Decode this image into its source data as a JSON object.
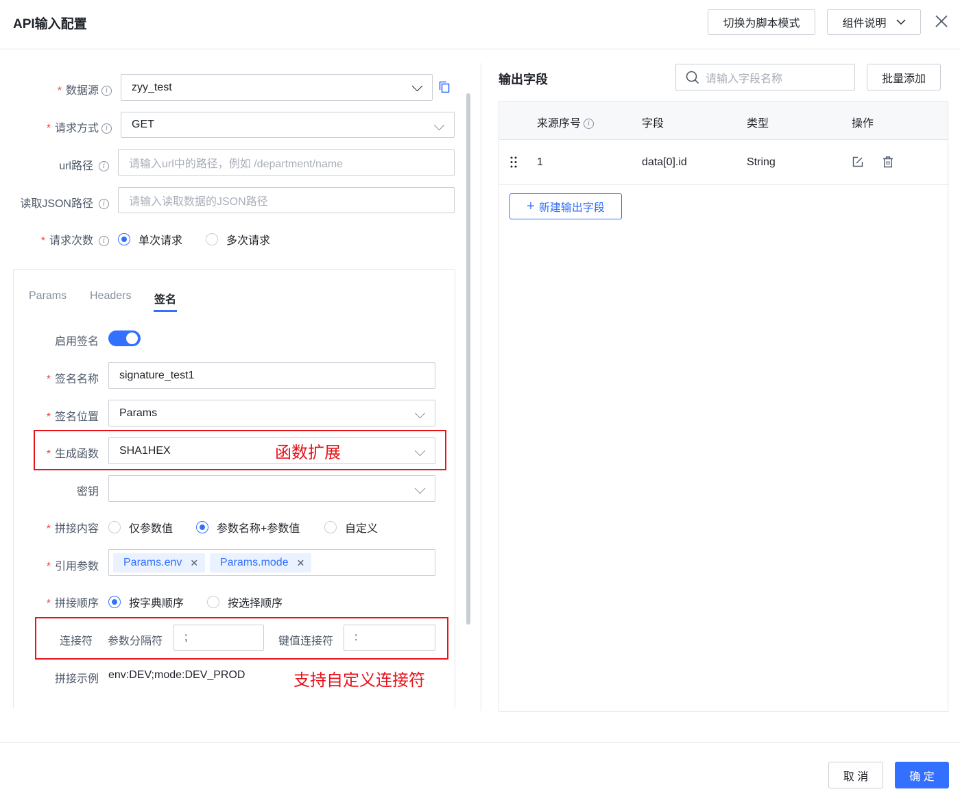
{
  "header": {
    "title": "API输入配置",
    "switch_script_label": "切换为脚本模式",
    "component_desc_label": "组件说明"
  },
  "form": {
    "datasource": {
      "label": "数据源",
      "value": "zyy_test"
    },
    "method": {
      "label": "请求方式",
      "value": "GET"
    },
    "url": {
      "label": "url路径",
      "placeholder": "请输入url中的路径，例如 /department/name"
    },
    "json_path": {
      "label": "读取JSON路径",
      "placeholder": "请输入读取数据的JSON路径"
    },
    "request_count": {
      "label": "请求次数",
      "options": [
        "单次请求",
        "多次请求"
      ],
      "selected": "单次请求"
    }
  },
  "tabs": [
    {
      "label": "Params"
    },
    {
      "label": "Headers"
    },
    {
      "label": "签名",
      "active": true
    }
  ],
  "signature": {
    "enable_label": "启用签名",
    "enabled": true,
    "name": {
      "label": "签名名称",
      "value": "signature_test1"
    },
    "position": {
      "label": "签名位置",
      "value": "Params"
    },
    "function": {
      "label": "生成函数",
      "value": "SHA1HEX"
    },
    "secret": {
      "label": "密钥",
      "value": ""
    },
    "concat_content": {
      "label": "拼接内容",
      "options": [
        "仅参数值",
        "参数名称+参数值",
        "自定义"
      ],
      "selected": "参数名称+参数值"
    },
    "ref_params": {
      "label": "引用参数",
      "tags": [
        "Params.env",
        "Params.mode"
      ]
    },
    "concat_order": {
      "label": "拼接顺序",
      "options": [
        "按字典顺序",
        "按选择顺序"
      ],
      "selected": "按字典顺序"
    },
    "connector": {
      "label": "连接符",
      "param_sep_label": "参数分隔符",
      "param_sep_value": ";",
      "kv_label": "键值连接符",
      "kv_value": ":"
    },
    "example": {
      "label": "拼接示例",
      "value": "env:DEV;mode:DEV_PROD"
    }
  },
  "annotations": {
    "function_ext": "函数扩展",
    "custom_connector": "支持自定义连接符"
  },
  "output": {
    "title": "输出字段",
    "search_placeholder": "请输入字段名称",
    "batch_add_label": "批量添加",
    "columns": [
      "来源序号",
      "字段",
      "类型",
      "操作"
    ],
    "rows": [
      {
        "index": "1",
        "field": "data[0].id",
        "type": "String"
      }
    ],
    "new_field_label": "新建输出字段"
  },
  "footer": {
    "cancel_label": "取 消",
    "confirm_label": "确 定"
  },
  "colors": {
    "primary": "#3370ff",
    "required": "#f53f3f",
    "annotation": "#e8121b"
  }
}
